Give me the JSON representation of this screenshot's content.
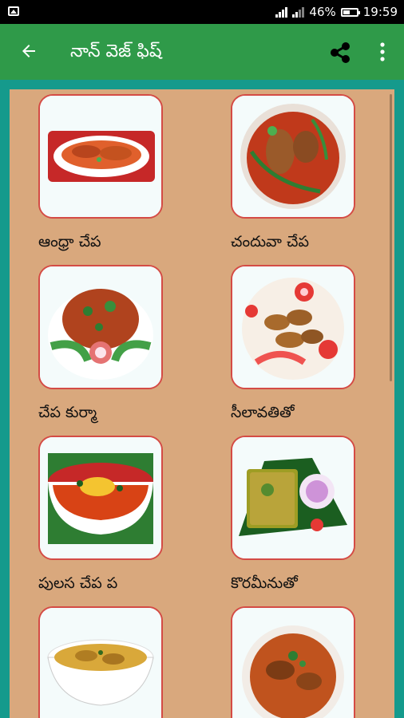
{
  "status_bar": {
    "battery_percent": "46%",
    "time": "19:59",
    "icons": [
      "gallery-icon",
      "wifi-signal-icon",
      "cell-signal-icon",
      "battery-icon"
    ]
  },
  "app_bar": {
    "title": "నాన్ వెజ్ ఫిష్",
    "icons": [
      "back-arrow-icon",
      "share-icon",
      "more-vert-icon"
    ]
  },
  "colors": {
    "status_bar": "#000000",
    "app_bar": "#2f9a49",
    "page_bg": "#159a8c",
    "content_bg": "#d9a87d",
    "card_border": "#d44b45"
  },
  "recipes": [
    {
      "label": "ఆంధ్రా చేప"
    },
    {
      "label": "చందువా చేప"
    },
    {
      "label": "చేప కుర్మా"
    },
    {
      "label": "సీలావతితో"
    },
    {
      "label": "పులస చేప ప"
    },
    {
      "label": "కొరమీనుతో"
    },
    {
      "label": ""
    },
    {
      "label": ""
    }
  ]
}
